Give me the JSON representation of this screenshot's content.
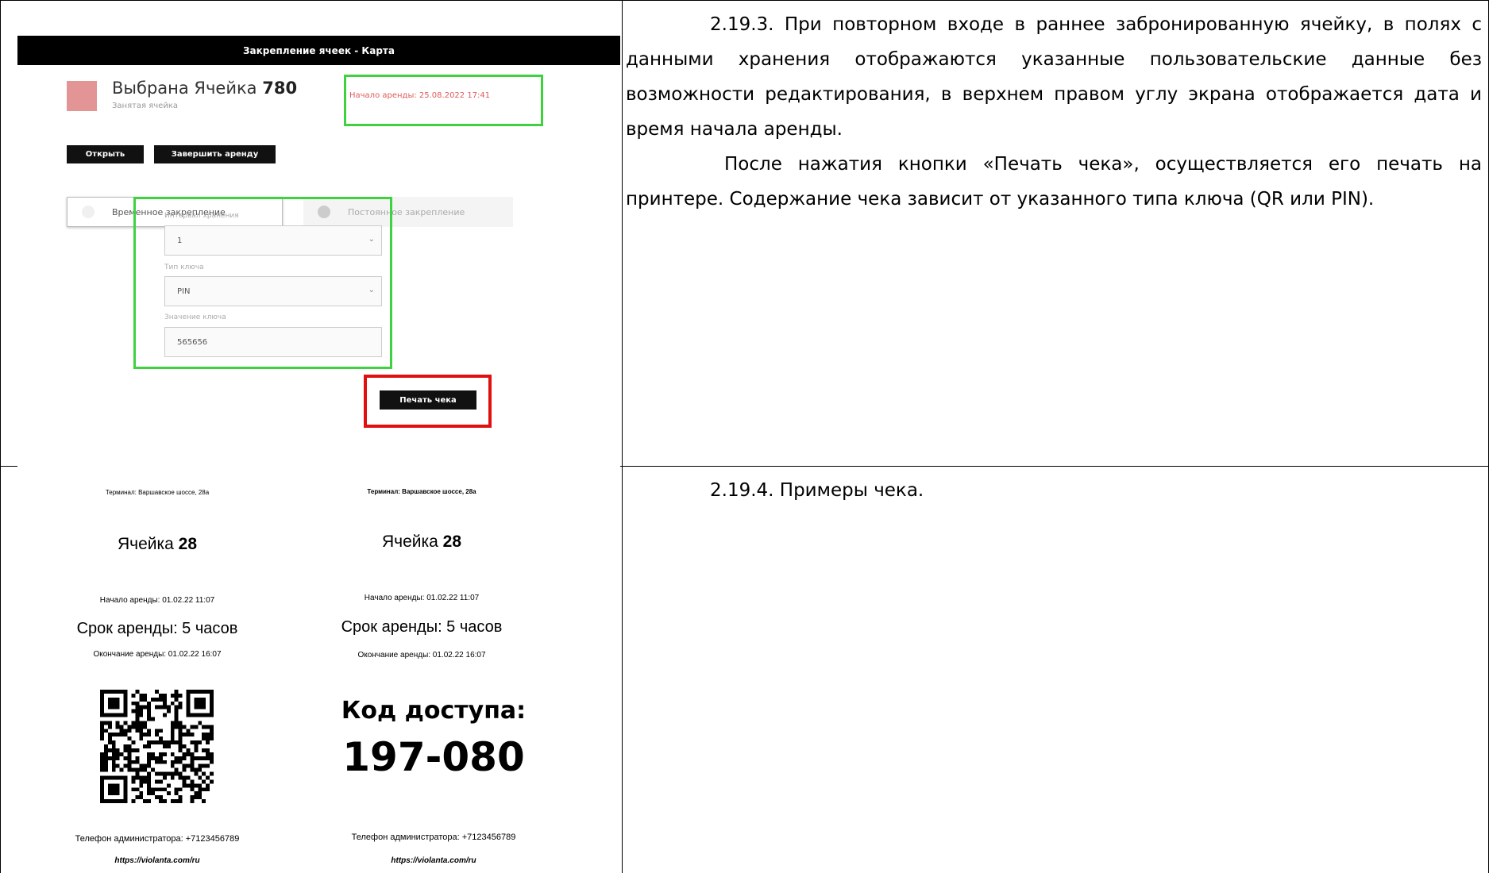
{
  "screenshot": {
    "header_title": "Закрепление ячеек - Карта",
    "cell_title_prefix": "Выбрана Ячейка",
    "cell_number": "780",
    "cell_subtitle": "Занятая ячейка",
    "rent_start": "Начало аренды: 25.08.2022 17:41",
    "open_button": "Открыть",
    "finish_button": "Завершить аренду",
    "radio_temporary": "Временное закрепление",
    "radio_permanent": "Постоянное закрепление",
    "interval_label": "Интервал хранения",
    "interval_value": "1",
    "key_type_label": "Тип ключа",
    "key_type_value": "PIN",
    "key_value_label": "Значение ключа",
    "key_value": "565656",
    "print_button": "Печать чека",
    "colors": {
      "highlight_green": "#3ed23e",
      "highlight_red": "#e01010",
      "occupied_cell": "#e39494"
    }
  },
  "text_right_top": {
    "para1": "2.19.3. При повторном входе в раннее забронированную ячейку, в полях с данными хранения отображаются указанные пользовательские данные без возможности редактирования, в верхнем правом углу экрана отображается дата и время начала аренды.",
    "para2": "После нажатия кнопки «Печать чека», осуществляется его печать на принтере. Содержание чека зависит от указанного типа ключа (QR или PIN)."
  },
  "text_right_bottom": {
    "para1": "2.19.4. Примеры чека."
  },
  "receipt_qr": {
    "terminal": "Терминал: Варшавское шоссе, 28а",
    "cell_prefix": "Ячейка",
    "cell_number": "28",
    "rent_start": "Начало аренды: 01.02.22 11:07",
    "rent_term": "Срок аренды: 5 часов",
    "rent_end": "Окончание аренды: 01.02.22 16:07",
    "qr_icon": "qr-code-icon",
    "admin_phone": "Телефон администратора: +7123456789",
    "url": "https://violanta.com/ru"
  },
  "receipt_pin": {
    "terminal": "Терминал: Варшавское шоссе, 28а",
    "cell_prefix": "Ячейка",
    "cell_number": "28",
    "rent_start": "Начало аренды: 01.02.22 11:07",
    "rent_term": "Срок аренды: 5 часов",
    "rent_end": "Окончание аренды: 01.02.22 16:07",
    "code_label": "Код доступа:",
    "code": "197-080",
    "admin_phone": "Телефон администратора: +7123456789",
    "url": "https://violanta.com/ru"
  }
}
